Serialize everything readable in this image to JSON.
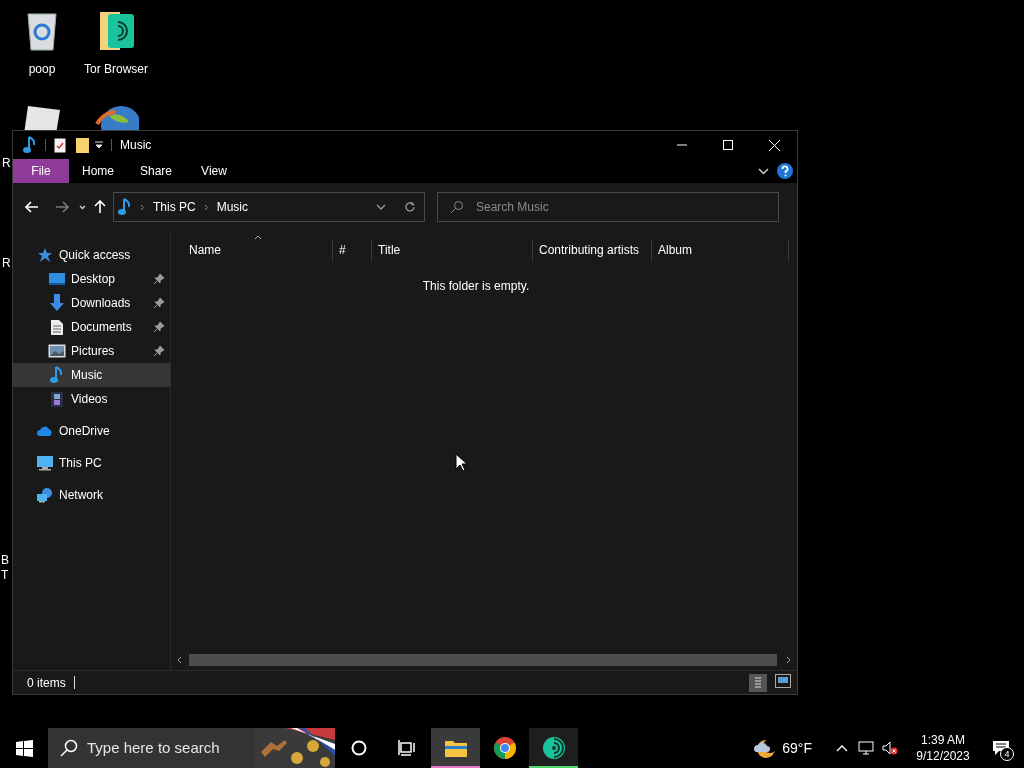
{
  "desktop": {
    "icons": [
      {
        "label": "poop",
        "kind": "recycle"
      },
      {
        "label": "Tor Browser",
        "kind": "tor"
      },
      {
        "kind": "roblox"
      },
      {
        "kind": "globe"
      }
    ],
    "cut_labels": [
      "R",
      "R",
      "B",
      "T"
    ]
  },
  "window": {
    "title": "Music",
    "ribbon_tabs": [
      {
        "label": "File",
        "selected": true
      },
      {
        "label": "Home",
        "selected": false
      },
      {
        "label": "Share",
        "selected": false
      },
      {
        "label": "View",
        "selected": false
      }
    ],
    "address": {
      "crumbs": [
        "This PC",
        "Music"
      ]
    },
    "search": {
      "placeholder": "Search Music"
    },
    "nav": [
      {
        "label": "Quick access",
        "kind": "quick",
        "selected": false,
        "children": [
          {
            "label": "Desktop",
            "kind": "desktop",
            "pinned": true,
            "selected": false
          },
          {
            "label": "Downloads",
            "kind": "downloads",
            "pinned": true,
            "selected": false
          },
          {
            "label": "Documents",
            "kind": "documents",
            "pinned": true,
            "selected": false
          },
          {
            "label": "Pictures",
            "kind": "pictures",
            "pinned": true,
            "selected": false
          },
          {
            "label": "Music",
            "kind": "music",
            "pinned": false,
            "selected": true
          },
          {
            "label": "Videos",
            "kind": "videos",
            "pinned": false,
            "selected": false
          }
        ]
      },
      {
        "label": "OneDrive",
        "kind": "onedrive",
        "selected": false
      },
      {
        "label": "This PC",
        "kind": "pc",
        "selected": false
      },
      {
        "label": "Network",
        "kind": "network",
        "selected": false
      }
    ],
    "columns": [
      "Name",
      "#",
      "Title",
      "Contributing artists",
      "Album"
    ],
    "empty_message": "This folder is empty.",
    "status_bar": {
      "items": "0 items"
    }
  },
  "taskbar": {
    "search_placeholder": "Type here to search",
    "apps": [
      {
        "kind": "explorer",
        "running": true,
        "focused": true
      },
      {
        "kind": "chrome",
        "running": false,
        "focused": false
      },
      {
        "kind": "tor",
        "running": true,
        "focused": false
      }
    ],
    "weather": "69°F",
    "time": "1:39 AM",
    "date": "9/12/2023",
    "notifications": "4"
  }
}
